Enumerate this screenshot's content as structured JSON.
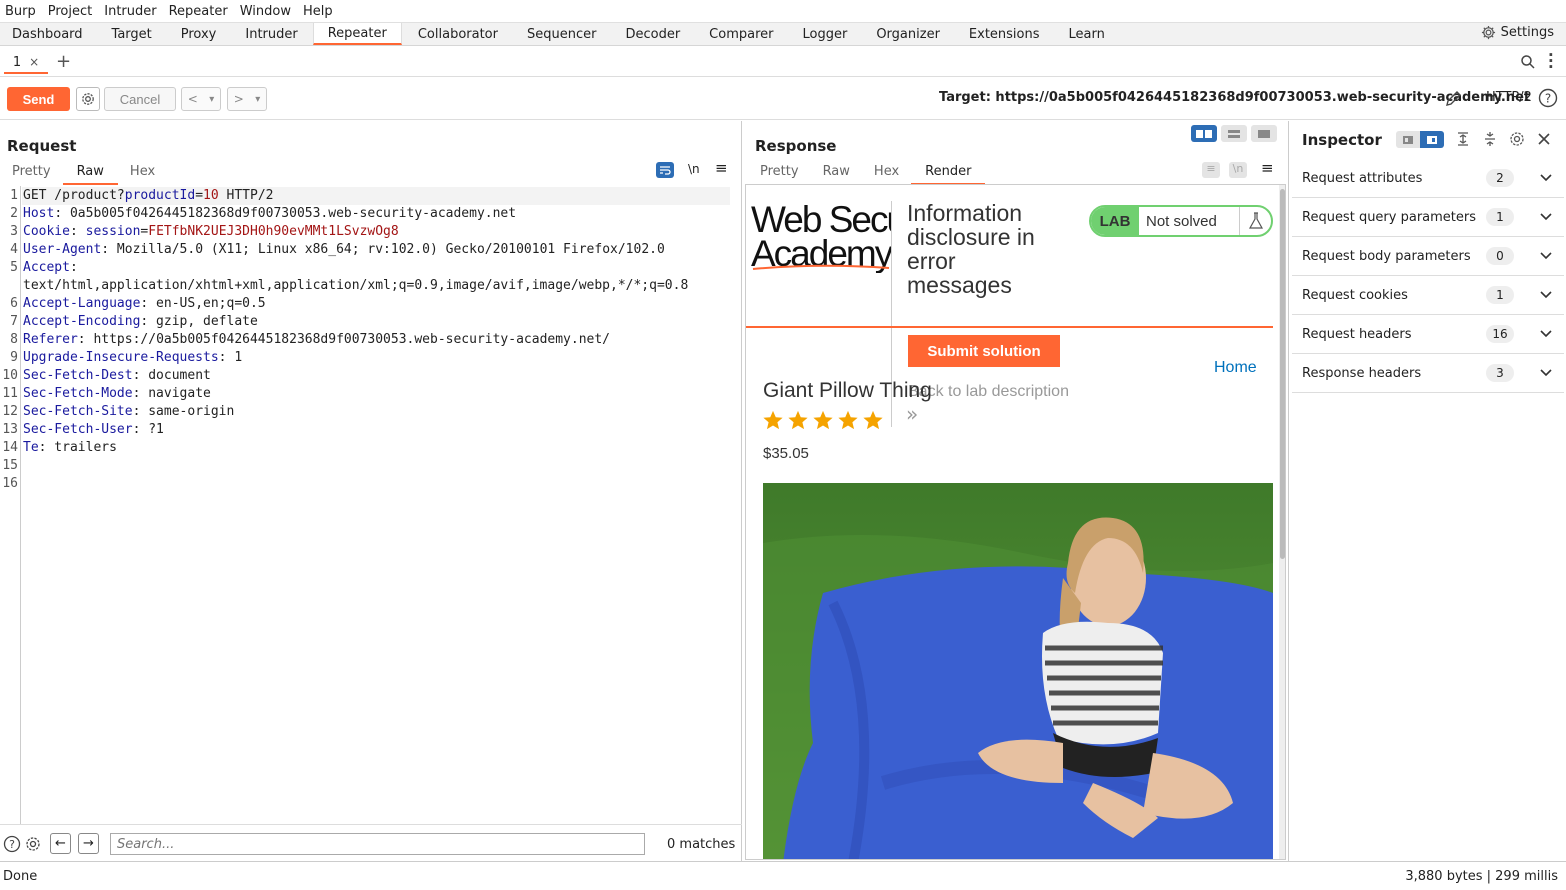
{
  "menu": [
    "Burp",
    "Project",
    "Intruder",
    "Repeater",
    "Window",
    "Help"
  ],
  "main_tabs": [
    "Dashboard",
    "Target",
    "Proxy",
    "Intruder",
    "Repeater",
    "Collaborator",
    "Sequencer",
    "Decoder",
    "Comparer",
    "Logger",
    "Organizer",
    "Extensions",
    "Learn"
  ],
  "active_main_tab": "Repeater",
  "settings_label": "Settings",
  "repeater_tab": {
    "label": "1",
    "close": "×",
    "add": "+"
  },
  "toolbar": {
    "send": "Send",
    "cancel": "Cancel",
    "back": "<",
    "forward": ">",
    "dropdown": "▾",
    "target": "Target: https://0a5b005f0426445182368d9f00730053.web-security-academy.net",
    "protocol": "HTTP/2"
  },
  "request": {
    "title": "Request",
    "tabs": [
      "Pretty",
      "Raw",
      "Hex"
    ],
    "active_tab": "Raw",
    "newline_toggle": "\\n",
    "lines": [
      {
        "n": "1",
        "parts": [
          {
            "t": "GET /product?",
            "c": ""
          },
          {
            "t": "productId",
            "c": "hk"
          },
          {
            "t": "=",
            "c": ""
          },
          {
            "t": "10",
            "c": "hv"
          },
          {
            "t": " HTTP/2",
            "c": ""
          }
        ]
      },
      {
        "n": "2",
        "parts": [
          {
            "t": "Host",
            "c": "hk"
          },
          {
            "t": ": 0a5b005f0426445182368d9f00730053.web-security-academy.net",
            "c": ""
          }
        ]
      },
      {
        "n": "3",
        "parts": [
          {
            "t": "Cookie",
            "c": "hk"
          },
          {
            "t": ": ",
            "c": ""
          },
          {
            "t": "session",
            "c": "hk"
          },
          {
            "t": "=",
            "c": ""
          },
          {
            "t": "FETfbNK2UEJ3DH0h90evMMt1LSvzwOg8",
            "c": "hv"
          }
        ]
      },
      {
        "n": "4",
        "parts": [
          {
            "t": "User-Agent",
            "c": "hk"
          },
          {
            "t": ": Mozilla/5.0 (X11; Linux x86_64; rv:102.0) Gecko/20100101 Firefox/102.0",
            "c": ""
          }
        ]
      },
      {
        "n": "5",
        "parts": [
          {
            "t": "Accept",
            "c": "hk"
          },
          {
            "t": ":",
            "c": ""
          }
        ]
      },
      {
        "n": "",
        "parts": [
          {
            "t": "text/html,application/xhtml+xml,application/xml;q=0.9,image/avif,image/webp,*/*;q=0.8",
            "c": ""
          }
        ]
      },
      {
        "n": "6",
        "parts": [
          {
            "t": "Accept-Language",
            "c": "hk"
          },
          {
            "t": ": en-US,en;q=0.5",
            "c": ""
          }
        ]
      },
      {
        "n": "7",
        "parts": [
          {
            "t": "Accept-Encoding",
            "c": "hk"
          },
          {
            "t": ": gzip, deflate",
            "c": ""
          }
        ]
      },
      {
        "n": "8",
        "parts": [
          {
            "t": "Referer",
            "c": "hk"
          },
          {
            "t": ": https://0a5b005f0426445182368d9f00730053.web-security-academy.net/",
            "c": ""
          }
        ]
      },
      {
        "n": "9",
        "parts": [
          {
            "t": "Upgrade-Insecure-Requests",
            "c": "hk"
          },
          {
            "t": ": 1",
            "c": ""
          }
        ]
      },
      {
        "n": "10",
        "parts": [
          {
            "t": "Sec-Fetch-Dest",
            "c": "hk"
          },
          {
            "t": ": document",
            "c": ""
          }
        ]
      },
      {
        "n": "11",
        "parts": [
          {
            "t": "Sec-Fetch-Mode",
            "c": "hk"
          },
          {
            "t": ": navigate",
            "c": ""
          }
        ]
      },
      {
        "n": "12",
        "parts": [
          {
            "t": "Sec-Fetch-Site",
            "c": "hk"
          },
          {
            "t": ": same-origin",
            "c": ""
          }
        ]
      },
      {
        "n": "13",
        "parts": [
          {
            "t": "Sec-Fetch-User",
            "c": "hk"
          },
          {
            "t": ": ?1",
            "c": ""
          }
        ]
      },
      {
        "n": "14",
        "parts": [
          {
            "t": "Te",
            "c": "hk"
          },
          {
            "t": ": trailers",
            "c": ""
          }
        ]
      },
      {
        "n": "15",
        "parts": []
      },
      {
        "n": "16",
        "parts": []
      }
    ],
    "search_placeholder": "Search...",
    "matches": "0 matches"
  },
  "response": {
    "title": "Response",
    "tabs": [
      "Pretty",
      "Raw",
      "Hex",
      "Render"
    ],
    "active_tab": "Render",
    "newline_toggle": "\\n",
    "render": {
      "logo_line1": "Web Secu",
      "logo_line2": "Academy",
      "lab_title_lines": [
        "Information",
        "disclosure in",
        "error",
        "messages"
      ],
      "lab_badge": "LAB",
      "lab_status": "Not solved",
      "submit": "Submit solution",
      "back_link": "Back to lab description",
      "back_chevrons": "»",
      "home": "Home",
      "product_name": "Giant Pillow Thing",
      "rating_stars": 5,
      "price": "$35.05"
    }
  },
  "inspector": {
    "title": "Inspector",
    "rows": [
      {
        "label": "Request attributes",
        "count": "2"
      },
      {
        "label": "Request query parameters",
        "count": "1"
      },
      {
        "label": "Request body parameters",
        "count": "0"
      },
      {
        "label": "Request cookies",
        "count": "1"
      },
      {
        "label": "Request headers",
        "count": "16"
      },
      {
        "label": "Response headers",
        "count": "3"
      }
    ]
  },
  "status": {
    "left": "Done",
    "right": "3,880 bytes | 299 millis"
  },
  "colors": {
    "accent": "#ff6633",
    "lab_green": "#70d070",
    "header_key": "#1a1a9e",
    "header_value": "#a31515",
    "link_blue": "#0071bc"
  }
}
